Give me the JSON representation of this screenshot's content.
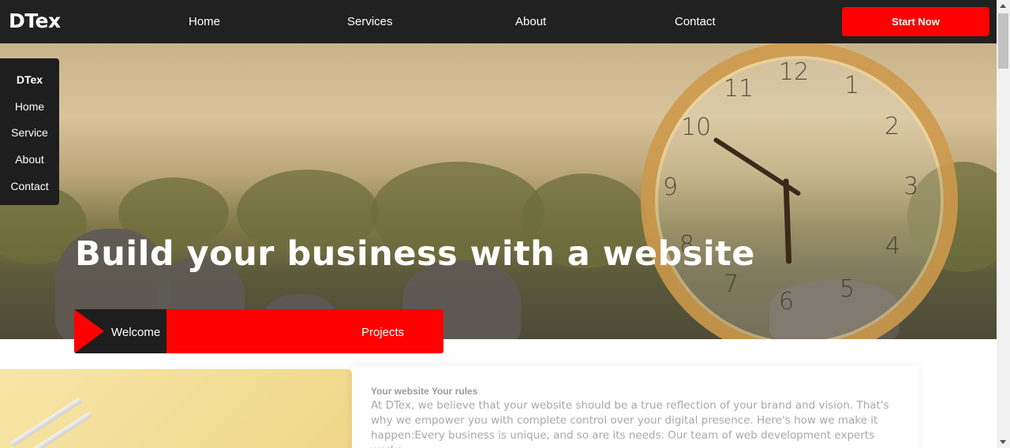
{
  "brand": {
    "logo": "DTex"
  },
  "nav": {
    "items": [
      "Home",
      "Services",
      "About",
      "Contact"
    ],
    "cta": "Start Now"
  },
  "side_menu": {
    "logo": "DTex",
    "items": [
      "Home",
      "Service",
      "About",
      "Contact"
    ]
  },
  "hero": {
    "title": "Build your business with a website",
    "clock_numbers": [
      "12",
      "1",
      "2",
      "3",
      "4",
      "5",
      "6",
      "7",
      "8",
      "9",
      "10",
      "11"
    ]
  },
  "tabs": {
    "welcome": "Welcome",
    "projects": "Projects"
  },
  "content": {
    "heading": "Your website Your rules",
    "body": "At DTex, we believe that your website should be a true reflection of your brand and vision. That's why we empower you with complete control over your digital presence. Here's how we make it happen:Every business is unique, and so are its needs. Our team of web development experts works"
  },
  "colors": {
    "accent": "#ff0000",
    "dark": "#212121"
  }
}
